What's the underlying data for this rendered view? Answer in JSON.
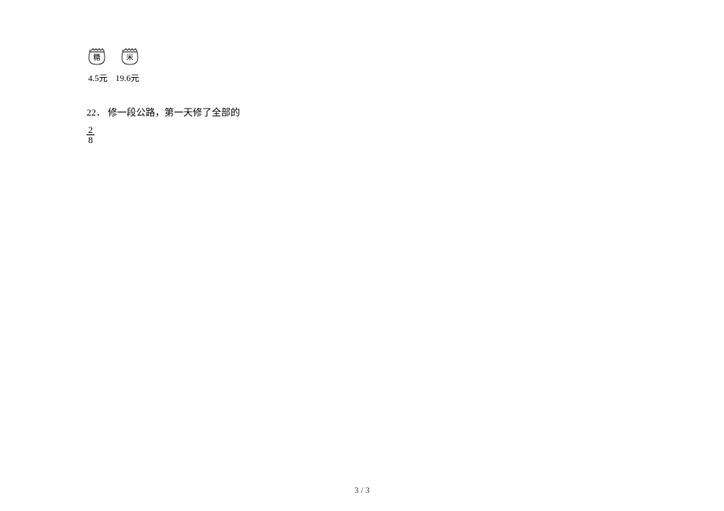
{
  "items": [
    {
      "label": "糖",
      "price": "4.5元"
    },
    {
      "label": "米",
      "price": "19.6元"
    }
  ],
  "question": {
    "number": "22．",
    "text": "修一段公路，第一天修了全部的",
    "fraction": {
      "numerator": "2",
      "denominator": "8"
    }
  },
  "footer": {
    "page_text": "3 / 3"
  }
}
